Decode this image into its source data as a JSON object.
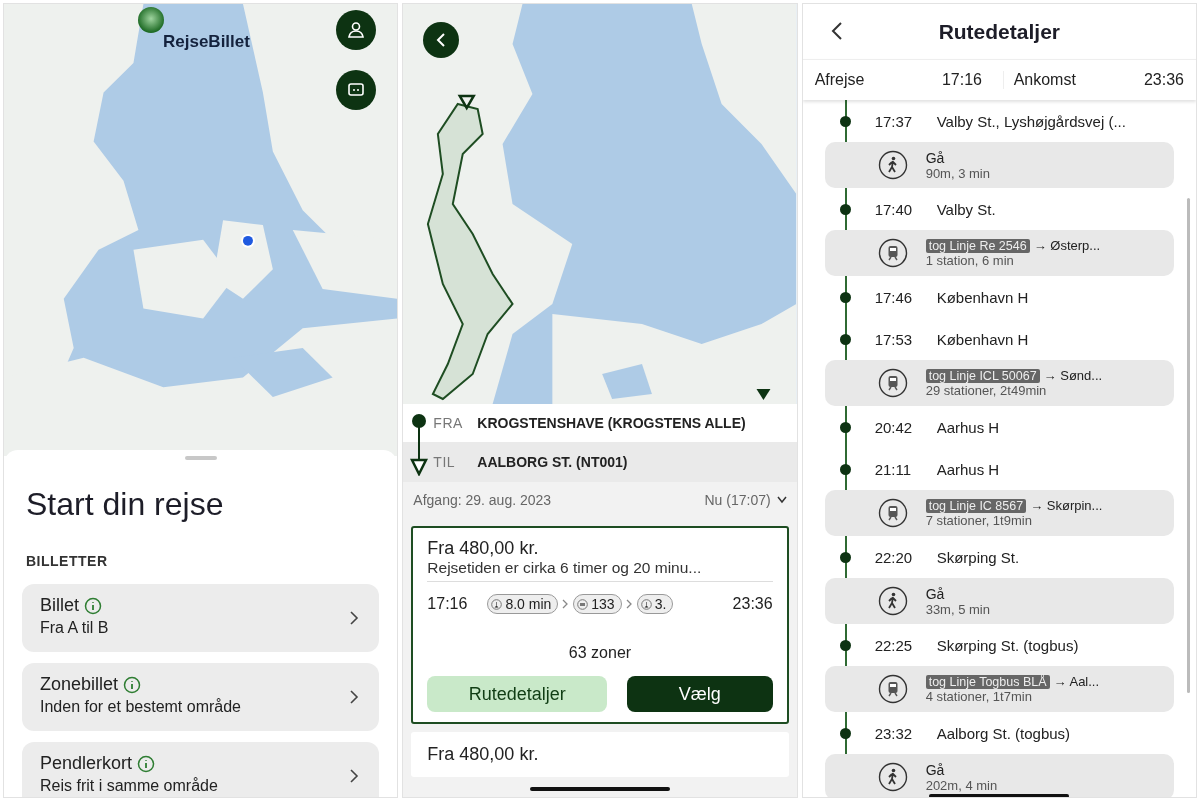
{
  "start_screen": {
    "marker_label": "RejseBillet",
    "sheet": {
      "title": "Start din rejse",
      "section": "BILLETTER",
      "tickets": [
        {
          "title": "Billet",
          "subtitle": "Fra A til B"
        },
        {
          "title": "Zonebillet",
          "subtitle": "Inden for et bestemt område"
        },
        {
          "title": "Pendlerkort",
          "subtitle": "Reis frit i samme område"
        }
      ]
    }
  },
  "trip_screen": {
    "from": {
      "label": "FRA",
      "value": "KROGSTENSHAVE (KROGSTENS ALLE)"
    },
    "to": {
      "label": "TIL",
      "value": "AALBORG ST. (NT001)"
    },
    "departure": "Afgang: 29. aug. 2023",
    "time_choice": "Nu (17:07)",
    "results": [
      {
        "selected": true,
        "price": "Fra 480,00 kr.",
        "summary": "Rejsetiden er cirka 6 timer og 20 minu...",
        "depart": "17:16",
        "arrive": "23:36",
        "legs": [
          {
            "kind": "walk",
            "label": "8.0 min"
          },
          {
            "kind": "bus",
            "label": "133"
          },
          {
            "kind": "walk",
            "label": "3."
          }
        ],
        "zones": "63 zoner",
        "buttons": [
          "Rutedetaljer",
          "Vælg"
        ]
      },
      {
        "selected": false,
        "price": "Fra 480,00 kr."
      }
    ]
  },
  "route_screen": {
    "title": "Rutedetaljer",
    "departure_label": "Afrejse",
    "departure": "17:16",
    "arrival_label": "Ankomst",
    "arrival": "23:36",
    "steps": [
      {
        "kind": "stop",
        "time": "17:37",
        "name": "Valby St., Lyshøjgårdsvej (..."
      },
      {
        "kind": "walk",
        "title": "Gå",
        "detail": "90m, 3 min"
      },
      {
        "kind": "stop",
        "time": "17:40",
        "name": "Valby St."
      },
      {
        "kind": "train",
        "line": "tog Linje Re 2546",
        "destination": "→ Østerp...",
        "detail": "1 station, 6 min"
      },
      {
        "kind": "stop",
        "time": "17:46",
        "name": "København H"
      },
      {
        "kind": "stop",
        "time": "17:53",
        "name": "København H"
      },
      {
        "kind": "train",
        "line": "tog Linje ICL 50067",
        "destination": "→ Sønd...",
        "detail": "29 stationer, 2t49min"
      },
      {
        "kind": "stop",
        "time": "20:42",
        "name": "Aarhus H"
      },
      {
        "kind": "stop",
        "time": "21:11",
        "name": "Aarhus H"
      },
      {
        "kind": "train",
        "line": "tog Linje IC 8567",
        "destination": "→ Skørpin...",
        "detail": "7 stationer, 1t9min"
      },
      {
        "kind": "stop",
        "time": "22:20",
        "name": "Skørping St."
      },
      {
        "kind": "walk",
        "title": "Gå",
        "detail": "33m, 5 min"
      },
      {
        "kind": "stop",
        "time": "22:25",
        "name": "Skørping St. (togbus)"
      },
      {
        "kind": "train",
        "line": "tog Linje Togbus BLÅ",
        "destination": "→ Aal...",
        "detail": "4 stationer, 1t7min"
      },
      {
        "kind": "stop",
        "time": "23:32",
        "name": "Aalborg St. (togbus)"
      },
      {
        "kind": "walk",
        "title": "Gå",
        "detail": "202m, 4 min"
      }
    ]
  }
}
